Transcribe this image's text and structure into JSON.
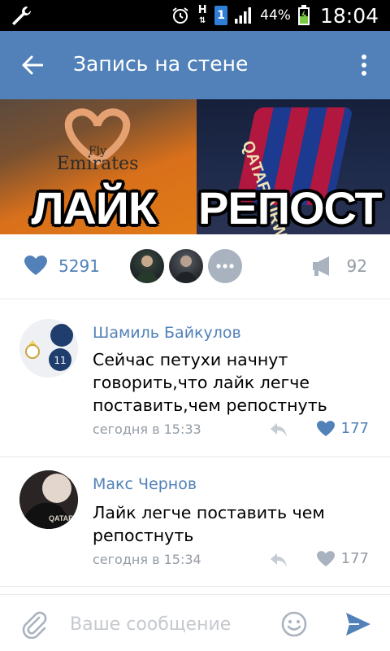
{
  "status_bar": {
    "network_type": "H",
    "sim_slot": "1",
    "battery_percent": "44%",
    "time": "18:04"
  },
  "app_bar": {
    "title": "Запись на стене"
  },
  "post": {
    "image_text_left": "ЛАЙК",
    "image_text_right": "РЕПОСТ",
    "jersey_text_left_line1": "Fly",
    "jersey_text_left_line2": "Emirates",
    "jersey_text_right": "QATAR AIRWAYS",
    "likes_count": "5291",
    "reposts_count": "92"
  },
  "comments": [
    {
      "author": "Шамиль Байкулов",
      "text": "Сейчас петухи начнут говорить,что лайк легче поставить,чем репостнуть",
      "time": "сегодня в 15:33",
      "likes": "177",
      "liked": true
    },
    {
      "author": "Макс Чернов",
      "text": "Лайк легче поставить чем репостнуть",
      "time": "сегодня в 15:34",
      "likes": "177",
      "liked": false
    }
  ],
  "composer": {
    "placeholder": "Ваше сообщение"
  },
  "colors": {
    "accent": "#5181b8",
    "muted": "#939ba5",
    "liked_icon": "#5181b8",
    "unliked_icon": "#a9b3bf"
  }
}
